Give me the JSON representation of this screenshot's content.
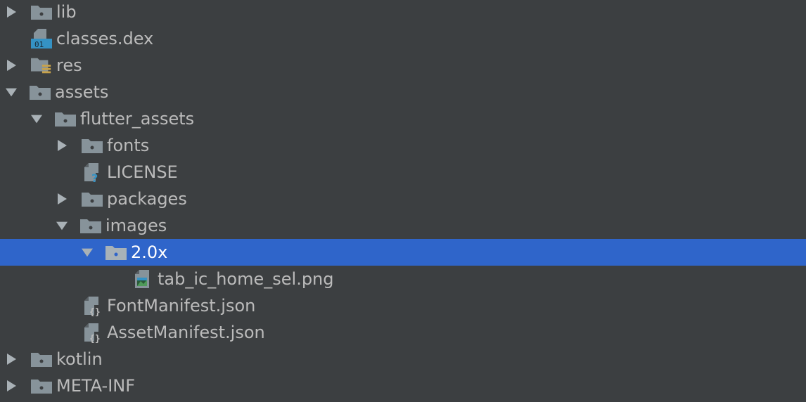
{
  "colors": {
    "background": "#3c3f41",
    "selection": "#2f65ca",
    "text": "#bbbbbb",
    "selected_text": "#ffffff",
    "folder_icon": "#87939a",
    "arrow": "#a9b1b6"
  },
  "tree": [
    {
      "label": "lib",
      "icon": "folder-icon",
      "expanded": false,
      "selected": false
    },
    {
      "label": "classes.dex",
      "icon": "dex-file-icon",
      "expanded": null,
      "selected": false
    },
    {
      "label": "res",
      "icon": "resource-folder-icon",
      "expanded": false,
      "selected": false
    },
    {
      "label": "assets",
      "icon": "folder-icon",
      "expanded": true,
      "selected": false
    },
    {
      "label": "flutter_assets",
      "icon": "folder-icon",
      "expanded": true,
      "selected": false
    },
    {
      "label": "fonts",
      "icon": "folder-icon",
      "expanded": false,
      "selected": false
    },
    {
      "label": "LICENSE",
      "icon": "unknown-file-icon",
      "expanded": null,
      "selected": false
    },
    {
      "label": "packages",
      "icon": "folder-icon",
      "expanded": false,
      "selected": false
    },
    {
      "label": "images",
      "icon": "folder-icon",
      "expanded": true,
      "selected": false
    },
    {
      "label": "2.0x",
      "icon": "folder-icon",
      "expanded": true,
      "selected": true
    },
    {
      "label": "tab_ic_home_sel.png",
      "icon": "image-file-icon",
      "expanded": null,
      "selected": false
    },
    {
      "label": "FontManifest.json",
      "icon": "json-file-icon",
      "expanded": null,
      "selected": false
    },
    {
      "label": "AssetManifest.json",
      "icon": "json-file-icon",
      "expanded": null,
      "selected": false
    },
    {
      "label": "kotlin",
      "icon": "folder-icon",
      "expanded": false,
      "selected": false
    },
    {
      "label": "META-INF",
      "icon": "folder-icon",
      "expanded": false,
      "selected": false
    }
  ]
}
